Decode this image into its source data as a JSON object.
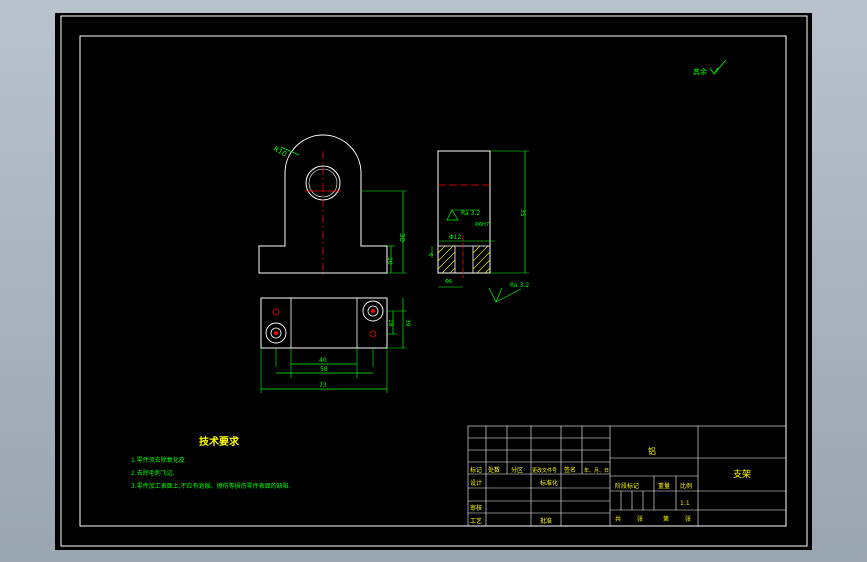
{
  "drawing": {
    "roughness_note": "其余",
    "dims": {
      "r10": "R10",
      "h30": "30",
      "h10": "10",
      "h_side": "35",
      "w6": "6",
      "w12": "Φ12",
      "w40": "40",
      "w58": "58",
      "w73": "73",
      "v18": "18",
      "v39": "39",
      "w_hole": "Φ6",
      "ra1": "Ra 3.2",
      "ra2": "Ra 3.2",
      "phi_label": "Φ6H7"
    },
    "tech_title": "技术要求",
    "tech_notes": [
      "1.零件须去除氧化皮.",
      "2.去除毛刺飞边.",
      "3.零件加工表面上,不应有划痕、擦伤等损伤零件表面的缺陷."
    ]
  },
  "title_block": {
    "material": "铝",
    "part_name": "支架",
    "scale": "1:1",
    "row_labels": [
      "标记",
      "处数",
      "分区",
      "更改文件号",
      "签名",
      "年、月、日"
    ],
    "design": "设计",
    "standardize": "标准化",
    "stage_mark": "阶段标记",
    "weight": "重量",
    "ratio": "比例",
    "review": "审核",
    "process": "工艺",
    "approve": "批准",
    "sheets": [
      "共",
      "张",
      "第",
      "张"
    ]
  },
  "colors": {
    "frame": "#ffffff",
    "outline": "#ffffff",
    "dimension": "#00ff00",
    "center": "#ff0000",
    "hatch": "#ffff00"
  }
}
